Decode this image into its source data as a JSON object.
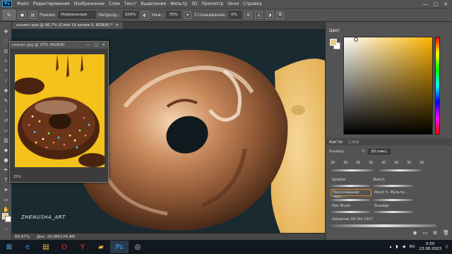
{
  "menubar": {
    "logo": "Ps",
    "items": [
      "Файл",
      "Редактирование",
      "Изображение",
      "Слои",
      "Текст",
      "Выделение",
      "Фильтр",
      "3D",
      "Просмотр",
      "Окно",
      "Справка"
    ],
    "window_controls": [
      "—",
      "□",
      "✕"
    ]
  },
  "options": {
    "mode_label": "Режим:",
    "mode_value": "Нормальный",
    "opacity_label": "Непрозр.:",
    "opacity_value": "100%",
    "pressure_label": "Наж.:",
    "pressure_value": "70%",
    "smoothing_label": "Сглаживание:",
    "smoothing_value": "0%"
  },
  "document": {
    "tab_title": "скелет.psd @ 66,7% (Слой 16 копия 5, RGB/8) *",
    "tab_close": "×",
    "status_zoom": "66,67%",
    "status_doc": "Док: 20,0M/174,4M"
  },
  "reference_window": {
    "title": "скелет.jpg @ 25% (RGB/8)",
    "controls": [
      "—",
      "□",
      "✕"
    ],
    "zoom": "25%"
  },
  "color_panel": {
    "tab": "Цвет",
    "fg_color": "#e9c98a",
    "bg_color": "#ffffff"
  },
  "brush_panel": {
    "tabs": [
      "Кисти",
      "Слои"
    ],
    "size_label": "Размер:",
    "size_value": "30 пикс.",
    "recent_sizes": [
      "30",
      "30",
      "30",
      "30",
      "30",
      "30",
      "30",
      "30"
    ],
    "brushes": [
      {
        "name": "Splatter",
        "selected": false
      },
      {
        "name": "Sketch",
        "selected": false
      },
      {
        "name": "Просачивание черн...",
        "selected": true
      },
      {
        "name": "Pencil 5. Мульти...",
        "selected": false
      },
      {
        "name": "Hair Brush",
        "selected": false
      },
      {
        "name": "Smudge",
        "selected": false
      },
      {
        "name": "Deharmer Oil Oct 2017",
        "selected": false
      }
    ]
  },
  "watermark": "ZHENUSHA_ART",
  "taskbar": {
    "apps": [
      "start",
      "ie",
      "explorer",
      "opera",
      "yandex",
      "files",
      "photoshop",
      "camera"
    ],
    "lang": "RU",
    "time": "0:50",
    "date": "23.08.2023"
  }
}
